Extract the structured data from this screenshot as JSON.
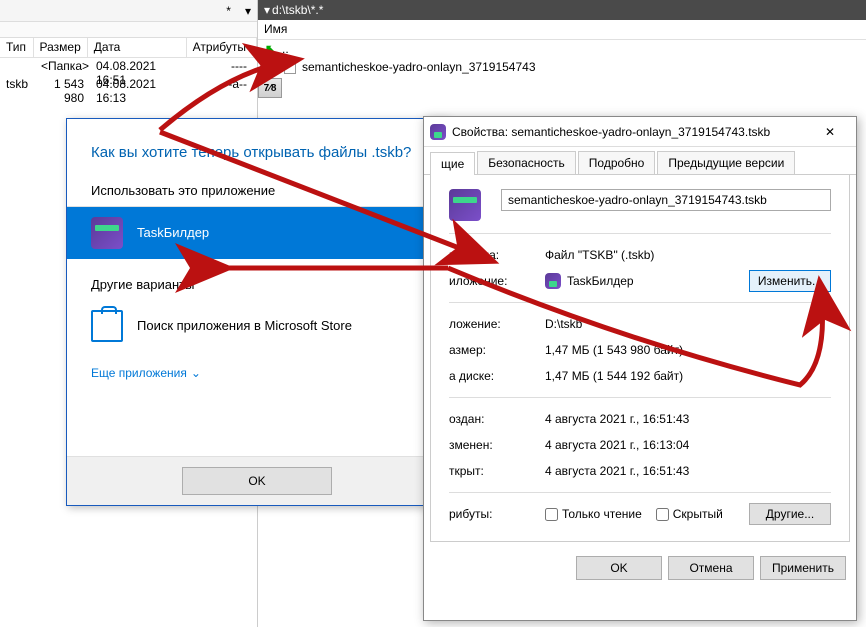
{
  "fm_left": {
    "star": "*",
    "cols": {
      "tip": "Тип",
      "razmer": "Размер",
      "data": "Дата",
      "attr": "Атрибуты"
    },
    "rows": [
      {
        "tip": "",
        "razmer": "<Папка>",
        "data": "04.08.2021 16:51",
        "attr": "----"
      },
      {
        "tip": "tskb",
        "razmer": "1 543 980",
        "data": "04.08.2021 16:13",
        "attr": "-a--"
      }
    ]
  },
  "fm_right": {
    "path": "d:\\tskb\\*.*",
    "name_col": "Имя",
    "updir": "..",
    "file": "semanticheskoe-yadro-onlayn_3719154743",
    "seven": "7⁄8"
  },
  "openwith": {
    "title": "Как вы хотите теперь открывать файлы .tskb?",
    "use_app": "Использовать это приложение",
    "app_label": "TaskБилдер",
    "other": "Другие варианты",
    "store": "Поиск приложения в Microsoft Store",
    "more": "Еще приложения",
    "ok": "OK"
  },
  "props": {
    "title": "Свойства: semanticheskoe-yadro-onlayn_3719154743.tskb",
    "tabs": [
      "щие",
      "Безопасность",
      "Подробно",
      "Предыдущие версии"
    ],
    "filename": "semanticheskoe-yadro-onlayn_3719154743.tskb",
    "rows": {
      "type_label": "п файла:",
      "type_val": "Файл \"TSKB\" (.tskb)",
      "app_label": "иложение:",
      "app_val": "TaskБилдер",
      "change": "Изменить...",
      "loc_label": "ложение:",
      "loc_val": "D:\\tskb",
      "size_label": "азмер:",
      "size_val": "1,47 МБ (1 543 980 байт)",
      "disk_label": "а диске:",
      "disk_val": "1,47 МБ (1 544 192 байт)",
      "created_label": "оздан:",
      "created_val": "4 августа 2021 г., 16:51:43",
      "modified_label": "зменен:",
      "modified_val": "4 августа 2021 г., 16:13:04",
      "opened_label": "ткрыт:",
      "opened_val": "4 августа 2021 г., 16:51:43",
      "attr_label": "рибуты:",
      "readonly": "Только чтение",
      "hidden": "Скрытый",
      "other": "Другие..."
    },
    "footer": {
      "ok": "OK",
      "cancel": "Отмена",
      "apply": "Применить"
    }
  }
}
